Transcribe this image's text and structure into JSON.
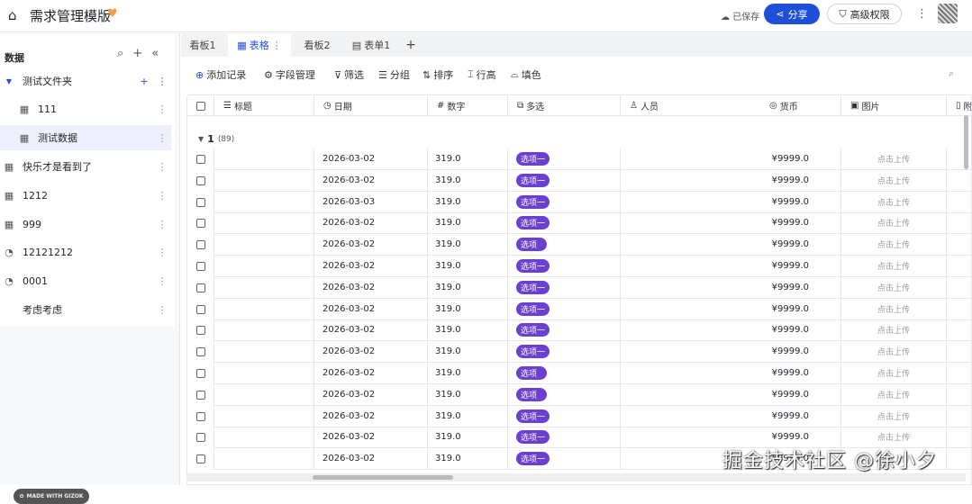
{
  "app": {
    "title": "需求管理模版",
    "saved": "已保存",
    "share": "分享",
    "permission": "高级权限",
    "icons": {
      "home": "home-icon",
      "favorite": "heart-icon"
    }
  },
  "sidebar": {
    "heading": "数据",
    "folder": "测试文件夹",
    "items": [
      {
        "label": "111",
        "icon": "table-icon",
        "indent": true
      },
      {
        "label": "测试数据",
        "icon": "table-icon",
        "indent": true,
        "selected": true
      },
      {
        "label": "快乐才是看到了",
        "icon": "table-icon"
      },
      {
        "label": "1212",
        "icon": "table-icon"
      },
      {
        "label": "999",
        "icon": "table-icon"
      },
      {
        "label": "12121212",
        "icon": "dashboard-icon"
      },
      {
        "label": "0001",
        "icon": "dashboard-icon"
      },
      {
        "label": "考虑考虑",
        "icon": ""
      }
    ],
    "badge": "MADE WITH GIZOK"
  },
  "tabs": [
    {
      "label": "看板1"
    },
    {
      "label": "表格",
      "active": true
    },
    {
      "label": "看板2"
    },
    {
      "label": "表单1"
    }
  ],
  "toolbar": {
    "add": "添加记录",
    "fields": "字段管理",
    "filter": "筛选",
    "group": "分组",
    "sort": "排序",
    "row_height": "行高",
    "fill": "填色"
  },
  "columns": [
    "标题",
    "日期",
    "数字",
    "多选",
    "人员",
    "货币",
    "图片",
    "附"
  ],
  "group": {
    "name": "1",
    "count": "(89)"
  },
  "rows": [
    {
      "date": "2026-03-02",
      "num": "319.0",
      "tag": "选项一",
      "cur": "¥9999.0",
      "img": "点击上传"
    },
    {
      "date": "2026-03-02",
      "num": "319.0",
      "tag": "选项一",
      "cur": "¥9999.0",
      "img": "点击上传"
    },
    {
      "date": "2026-03-03",
      "num": "319.0",
      "tag": "选项一",
      "cur": "¥9999.0",
      "img": "点击上传"
    },
    {
      "date": "2026-03-02",
      "num": "319.0",
      "tag": "选项一",
      "cur": "¥9999.0",
      "img": "点击上传"
    },
    {
      "date": "2026-03-02",
      "num": "319.0",
      "tag": "选项",
      "cur": "¥9999.0",
      "img": "点击上传"
    },
    {
      "date": "2026-03-02",
      "num": "319.0",
      "tag": "选项一",
      "cur": "¥9999.0",
      "img": "点击上传"
    },
    {
      "date": "2026-03-02",
      "num": "319.0",
      "tag": "选项一",
      "cur": "¥9999.0",
      "img": "点击上传"
    },
    {
      "date": "2026-03-02",
      "num": "319.0",
      "tag": "选项一",
      "cur": "¥9999.0",
      "img": "点击上传"
    },
    {
      "date": "2026-03-02",
      "num": "319.0",
      "tag": "选项一",
      "cur": "¥9999.0",
      "img": "点击上传"
    },
    {
      "date": "2026-03-02",
      "num": "319.0",
      "tag": "选项一",
      "cur": "¥9999.0",
      "img": "点击上传"
    },
    {
      "date": "2026-03-02",
      "num": "319.0",
      "tag": "选项",
      "cur": "¥9999.0",
      "img": "点击上传"
    },
    {
      "date": "2026-03-02",
      "num": "319.0",
      "tag": "选项",
      "cur": "¥9999.0",
      "img": "点击上传"
    },
    {
      "date": "2026-03-02",
      "num": "319.0",
      "tag": "选项一",
      "cur": "¥9999.0",
      "img": "点击上传"
    },
    {
      "date": "2026-03-02",
      "num": "319.0",
      "tag": "选项一",
      "cur": "¥9999.0",
      "img": "点击上传"
    },
    {
      "date": "2026-03-02",
      "num": "319.0",
      "tag": "选项一",
      "cur": "¥9999.0",
      "img": "点击上传"
    }
  ],
  "watermark": "掘金技术社区 @徐小夕",
  "colors": {
    "accent": "#1d4fd8",
    "tag": "#6b3fd1"
  }
}
